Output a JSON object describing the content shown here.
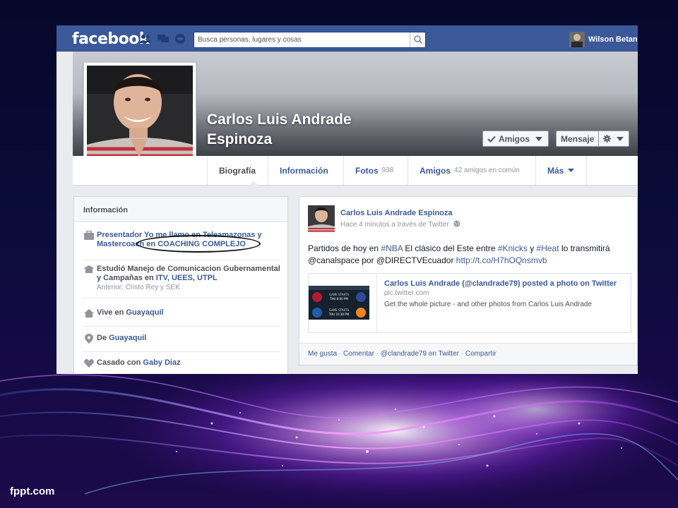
{
  "slide": {
    "brand": "fppt.com"
  },
  "topbar": {
    "logo": "facebook",
    "search_placeholder": "Busca personas, lugares y cosas",
    "user_name": "Wilson Betan",
    "icons": [
      "friends-icon",
      "messages-icon",
      "notifications-icon",
      "search-icon"
    ]
  },
  "profile": {
    "name_line1": "Carlos Luis Andrade",
    "name_line2": "Espinoza",
    "friends_button": "Amigos",
    "message_button": "Mensaje"
  },
  "tabs": [
    {
      "label": "Biografía",
      "sub": ""
    },
    {
      "label": "Información",
      "sub": ""
    },
    {
      "label": "Fotos",
      "sub": "938"
    },
    {
      "label": "Amigos",
      "sub": "42 amigos en común"
    },
    {
      "label": "Más",
      "sub": ""
    }
  ],
  "info": {
    "header": "Información",
    "work": {
      "line1": "Presentador Yo me llamo en Teleamazonas y",
      "line2_a": "Mastercoach en ",
      "line2_b": "COACHING COMPLEJO"
    },
    "study": {
      "line1_a": "Estudió Manejo de Comunicacion Gubernamental",
      "line2_a": "y Campañas en ",
      "line2_b": "ITV, UEES, UTPL",
      "line3": "Anterior: Cristo Rey y SEK"
    },
    "lives": {
      "prefix": "Vive en ",
      "place": "Guayaquil"
    },
    "from": {
      "prefix": "De ",
      "place": "Guayaquil"
    },
    "married": {
      "prefix": "Casado con ",
      "person": "Gaby Diaz"
    }
  },
  "post": {
    "author": "Carlos Luis Andrade Espinoza",
    "meta": "Hace 4 minutos a través de Twitter",
    "body": {
      "p1": "Partidos de hoy en ",
      "h_nba": "#NBA",
      "p2": " El clásico del Este entre ",
      "h_knicks": "#Knicks",
      "p3": " y ",
      "h_heat": "#Heat",
      "p4": " lo transmitirá",
      "p5": "@canalspace por @DIRECTVEcuador ",
      "link": "http://t.co/H7hOQnsmvb"
    },
    "attachment": {
      "title": "Carlos Luis Andrade (@clandrade79) posted a photo on Twitter",
      "domain": "pic.twitter.com",
      "desc": "Get the whole picture - and other photos from Carlos Luis Andrade",
      "thumb_lines": [
        "GAME STARTS",
        "THU 8:00 PM",
        "GAME STARTS",
        "THU 10:30 PM"
      ]
    },
    "actions": {
      "like": "Me gusta",
      "comment": "Comentar",
      "via": "@clandrade79 on Twitter",
      "share": "Compartir",
      "sep": " · "
    }
  },
  "colors": {
    "fb_blue": "#3b5998",
    "link": "#3b5998",
    "muted": "#90949c"
  }
}
